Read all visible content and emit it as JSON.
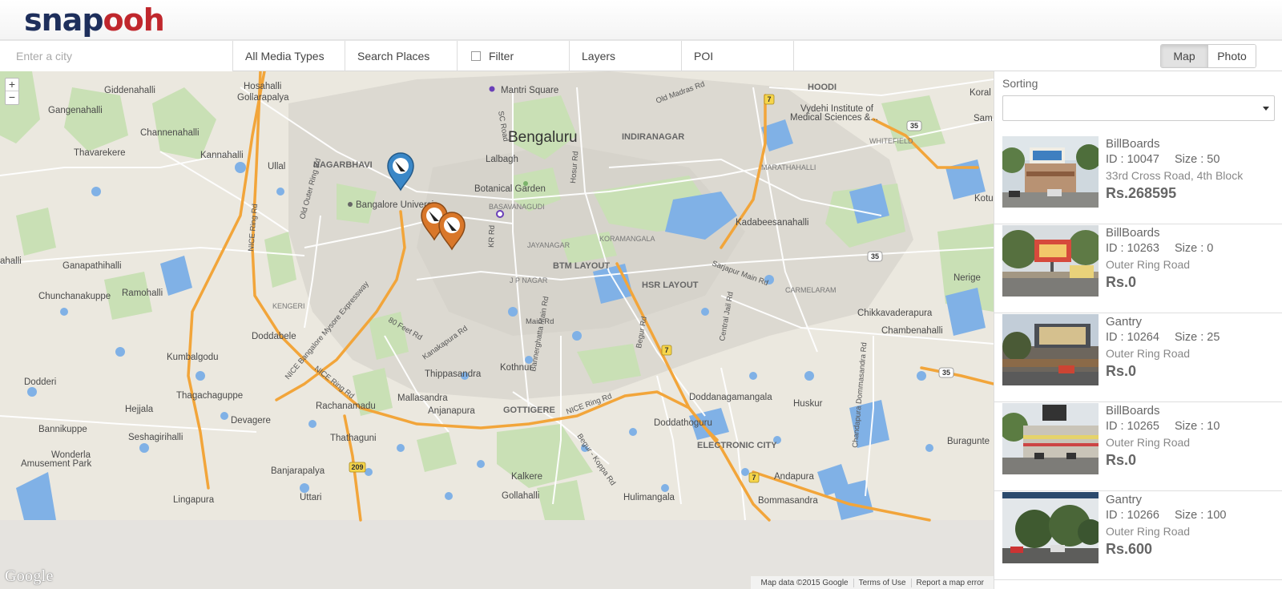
{
  "app": {
    "logo_part1": "snap",
    "logo_part2": "ooh"
  },
  "toolbar": {
    "city_placeholder": "Enter a city",
    "media_types": "All Media Types",
    "search_places": "Search Places",
    "filter": "Filter",
    "layers": "Layers",
    "poi": "POI",
    "view_map": "Map",
    "view_photo": "Photo",
    "active_view": "Map"
  },
  "map": {
    "zoom_in": "+",
    "zoom_out": "−",
    "google_logo": "Google",
    "attribution": {
      "data": "Map data ©2015 Google",
      "terms": "Terms of Use",
      "report": "Report a map error"
    },
    "city_label": "Bengaluru",
    "places": [
      "Giddenahalli",
      "Hosahalli",
      "Gollarapalya",
      "Mantri Square",
      "Gangenahalli",
      "Channenahalli",
      "Thavarekere",
      "Kannahalli",
      "Ullal",
      "NAGARBHAVI",
      "Bangalore University",
      "Lalbagh Botanical Garden",
      "INDIRANAGAR",
      "HOODI",
      "Vydehi Institute of Medical Sciences &...",
      "WHITEFIELD",
      "MARATHAHALLI",
      "Kadabeesanahalli",
      "BASAVANAGUDI",
      "JAYANAGAR",
      "KORAMANGALA",
      "BTM LAYOUT",
      "HSR LAYOUT",
      "J P NAGAR",
      "Ganapathihalli",
      "Ramohalli",
      "Chunchanakuppe",
      "KENGERI",
      "Doddabele",
      "Kumbalgodu",
      "Dodderi",
      "Thippasandra",
      "Kothnur",
      "Mallasandra",
      "Anjanapura",
      "GOTTIGERE",
      "Thagachaguppe",
      "Hejjala",
      "Devagere",
      "Rachanamadu",
      "Thathaguni",
      "Bannikuppe",
      "Seshagirihalli",
      "Wonderla Amusement Park",
      "Banjarapalya",
      "Lingapura",
      "Uttari",
      "Kalkere",
      "Gollahalli",
      "Hulimangala",
      "Doddanagamangala",
      "Doddathoguru",
      "ELECTRONIC CITY",
      "Huskur",
      "Andapura",
      "Bommasandra",
      "Buragunte",
      "Chikkavaderapura",
      "Chambenahalli",
      "Nerige",
      "CARMELARAM",
      "Kotur",
      "Koral",
      "Sam"
    ],
    "roads": [
      "NICE Ring Rd",
      "NICE Bangalore Mysore Expressway",
      "Sarjapur Main Rd",
      "Outer Ring Rd",
      "80 Feet Rd",
      "Kanakapura Rd",
      "Bannerghatta Main Rd",
      "Hosur Rd",
      "Old Madras Rd",
      "Chandapura Dommasandra Rd"
    ],
    "highway_shields": [
      "7",
      "35",
      "209"
    ],
    "colors": {
      "land": "#e8e5dc",
      "urban": "#d9d6cf",
      "water": "#7fb0e4",
      "park": "#c7dfb3",
      "highway": "#f0a534",
      "arterial": "#ffffff"
    }
  },
  "sidebar": {
    "sorting_label": "Sorting",
    "sorting_value": "",
    "listings": [
      {
        "type": "BillBoards",
        "id": "ID : 10047",
        "size": "Size : 50",
        "address": "33rd Cross Road, 4th Block",
        "price": "Rs.268595"
      },
      {
        "type": "BillBoards",
        "id": "ID : 10263",
        "size": "Size : 0",
        "address": "Outer Ring Road",
        "price": "Rs.0"
      },
      {
        "type": "Gantry",
        "id": "ID : 10264",
        "size": "Size : 25",
        "address": "Outer Ring Road",
        "price": "Rs.0"
      },
      {
        "type": "BillBoards",
        "id": "ID : 10265",
        "size": "Size : 10",
        "address": "Outer Ring Road",
        "price": "Rs.0"
      },
      {
        "type": "Gantry",
        "id": "ID : 10266",
        "size": "Size : 100",
        "address": "Outer Ring Road",
        "price": "Rs.600"
      }
    ]
  }
}
